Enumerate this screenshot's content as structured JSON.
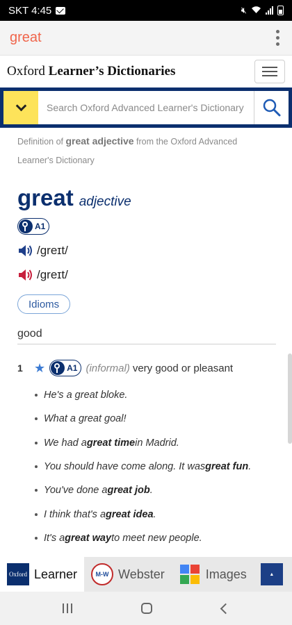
{
  "status_bar": {
    "carrier_time": "SKT 4:45"
  },
  "app_bar": {
    "search_term": "great"
  },
  "header": {
    "logo_prefix": "Oxford",
    "logo_main": " Learner’s Dictionaries"
  },
  "search": {
    "placeholder": "Search Oxford Advanced Learner's Dictionary"
  },
  "source_note": {
    "prefix": "Definition of ",
    "term": "great adjective",
    "suffix": " from the Oxford Advanced Learner's Dictionary"
  },
  "entry": {
    "headword": "great",
    "pos": "adjective",
    "level": "A1",
    "pron_british": "/ɡreɪt/",
    "pron_american": "/ɡreɪt/",
    "idioms_label": "Idioms",
    "sense_heading": "good",
    "sense_1": {
      "number": "1",
      "level": "A1",
      "label": "(informal)",
      "definition": "very good or pleasant"
    },
    "examples": [
      {
        "before": "He's a great bloke.",
        "bold": "",
        "after": ""
      },
      {
        "before": "What a great goal!",
        "bold": "",
        "after": ""
      },
      {
        "before": "We had a ",
        "bold": "great time",
        "after": " in Madrid."
      },
      {
        "before": "You should have come along. It was ",
        "bold": "great fun",
        "after": "."
      },
      {
        "before": "You've done a ",
        "bold": "great job",
        "after": "."
      },
      {
        "before": "I think that's a ",
        "bold": "great idea",
        "after": "."
      },
      {
        "before": "It's a ",
        "bold": "great way",
        "after": " to meet new people."
      }
    ]
  },
  "tabs": [
    {
      "label": "Learner",
      "icon": "oxford-icon",
      "active": true
    },
    {
      "label": "Webster",
      "icon": "merriam-webster-icon",
      "active": false
    },
    {
      "label": "Images",
      "icon": "google-images-icon",
      "active": false
    },
    {
      "label": "",
      "icon": "longman-icon",
      "active": false
    }
  ],
  "colors": {
    "brand_navy": "#0b2f6e",
    "accent_yellow": "#fde35a",
    "search_term": "#f0654b",
    "british_audio": "#1e3f8a",
    "american_audio": "#c8203d"
  }
}
